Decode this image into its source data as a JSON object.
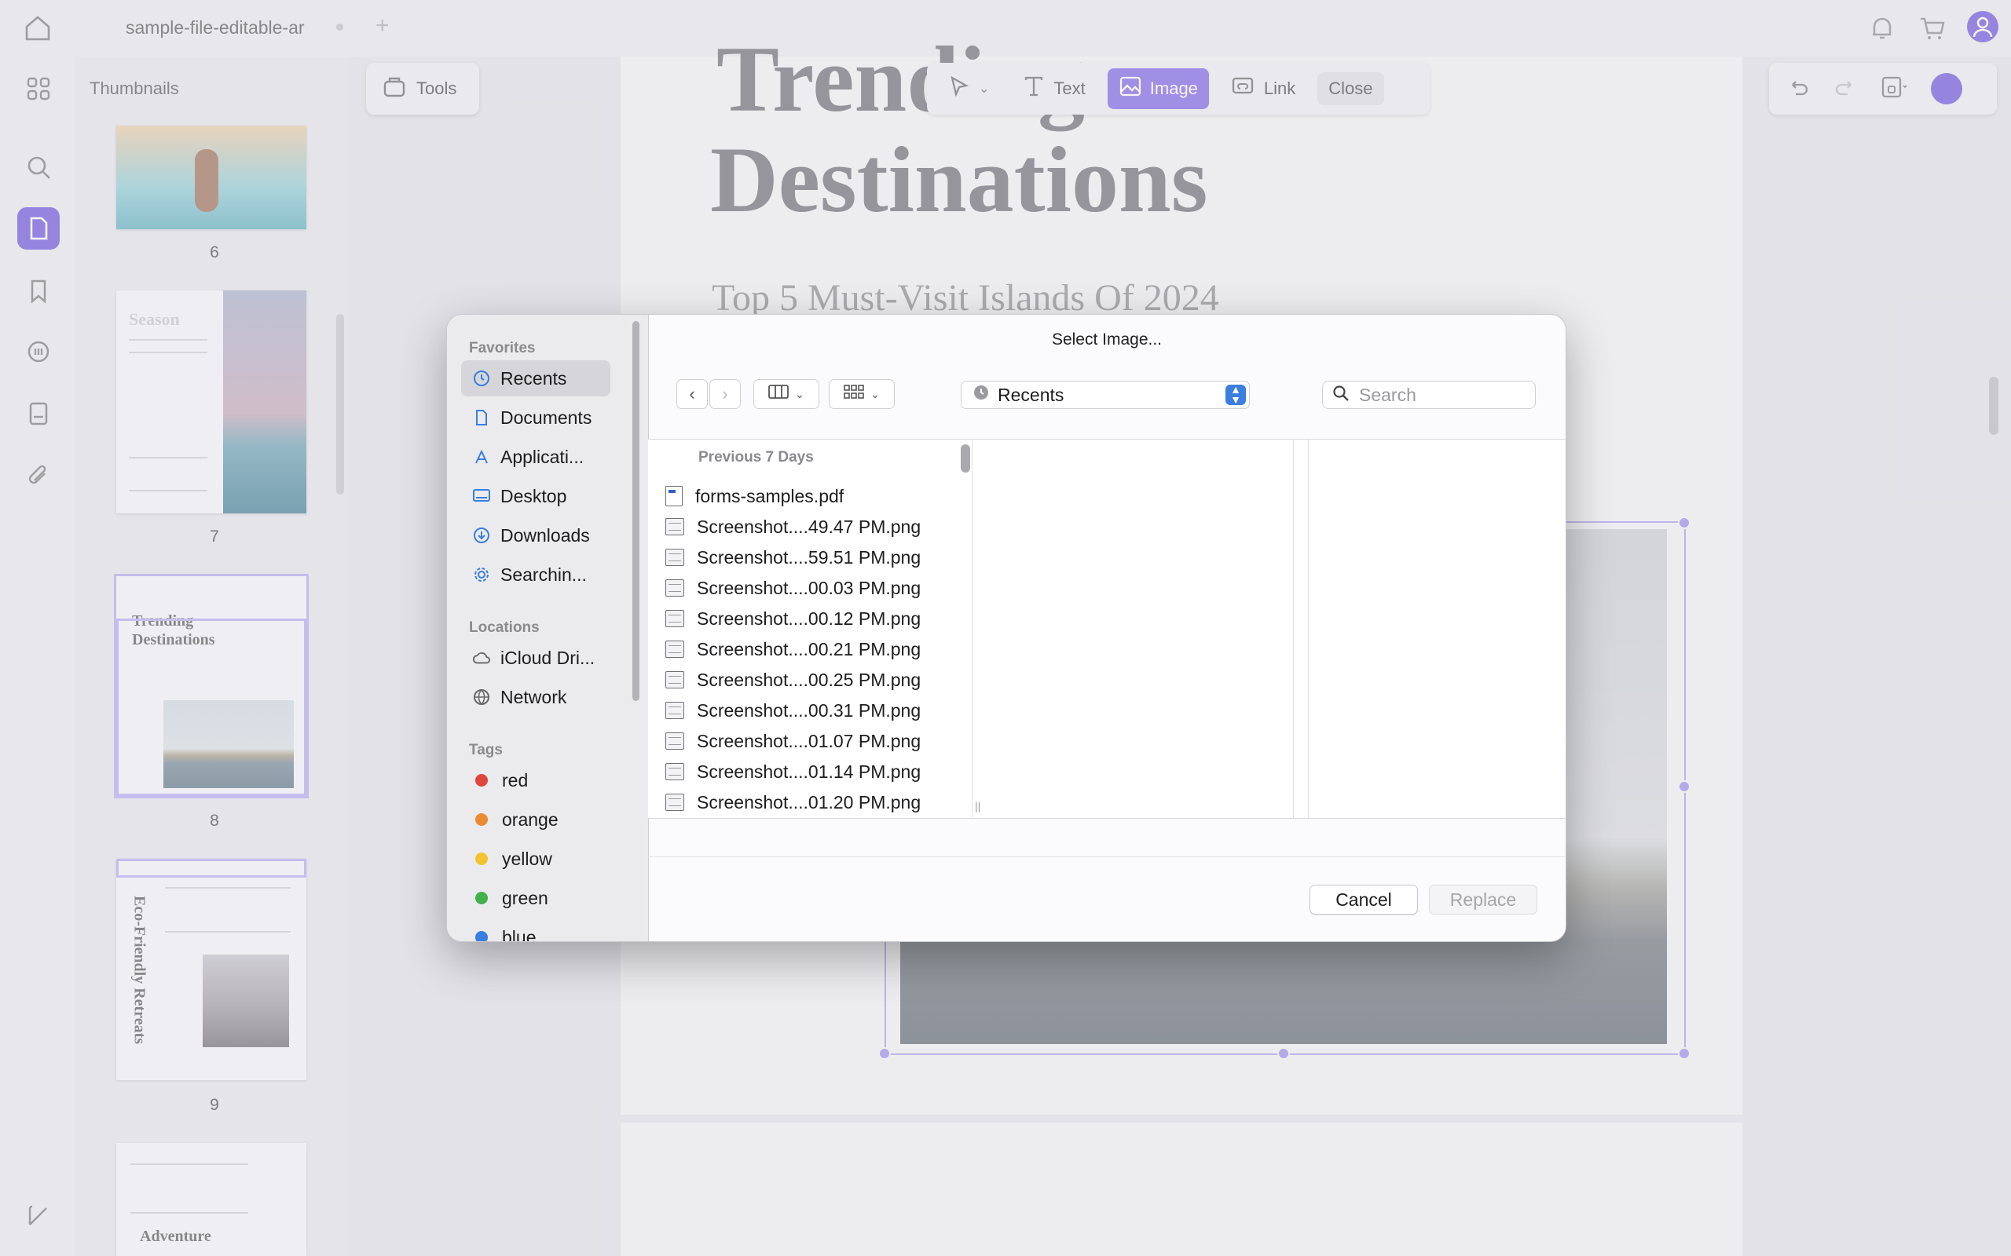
{
  "app": {
    "tab_title": "sample-file-editable-ar",
    "thumbnails_title": "Thumbnails",
    "tools_label": "Tools",
    "page_numbers": [
      "6",
      "7",
      "8",
      "9"
    ],
    "thumb_texts": {
      "p7_title": "Season",
      "p8_title1": "Trending",
      "p8_title2": "Destinations",
      "p9_title": "Eco-Friendly Retreats",
      "p10_title": "Adventure"
    }
  },
  "edit_toolbar": {
    "text_label": "Text",
    "image_label": "Image",
    "link_label": "Link",
    "close_label": "Close"
  },
  "document": {
    "title_line1": "Trending",
    "title_line2": "Destinations",
    "subtitle": "Top 5 Must-Visit Islands Of 2024"
  },
  "dialog": {
    "title": "Select Image...",
    "favorites_heading": "Favorites",
    "favorites": [
      {
        "label": "Recents",
        "icon": "clock-icon"
      },
      {
        "label": "Documents",
        "icon": "document-icon"
      },
      {
        "label": "Applicati...",
        "icon": "applications-icon"
      },
      {
        "label": "Desktop",
        "icon": "desktop-icon"
      },
      {
        "label": "Downloads",
        "icon": "download-icon"
      },
      {
        "label": "Searchin...",
        "icon": "gear-icon"
      }
    ],
    "locations_heading": "Locations",
    "locations": [
      {
        "label": "iCloud Dri...",
        "icon": "cloud-icon"
      },
      {
        "label": "Network",
        "icon": "globe-icon"
      }
    ],
    "tags_heading": "Tags",
    "tags": [
      {
        "label": "red",
        "color": "#e0443e"
      },
      {
        "label": "orange",
        "color": "#ec8a35"
      },
      {
        "label": "yellow",
        "color": "#f2c230"
      },
      {
        "label": "green",
        "color": "#41b14b"
      },
      {
        "label": "blue",
        "color": "#3b7de0"
      }
    ],
    "location_select": "Recents",
    "search_placeholder": "Search",
    "section_heading": "Previous 7 Days",
    "files": [
      "forms-samples.pdf",
      "Screenshot....49.47 PM.png",
      "Screenshot....59.51 PM.png",
      "Screenshot....00.03 PM.png",
      "Screenshot....00.12 PM.png",
      "Screenshot....00.21 PM.png",
      "Screenshot....00.25 PM.png",
      "Screenshot....00.31 PM.png",
      "Screenshot....01.07 PM.png",
      "Screenshot....01.14 PM.png",
      "Screenshot....01.20 PM.png"
    ],
    "cancel_label": "Cancel",
    "replace_label": "Replace"
  },
  "colors": {
    "accent": "#6a52d9",
    "selection_blue": "#3b7de0"
  }
}
